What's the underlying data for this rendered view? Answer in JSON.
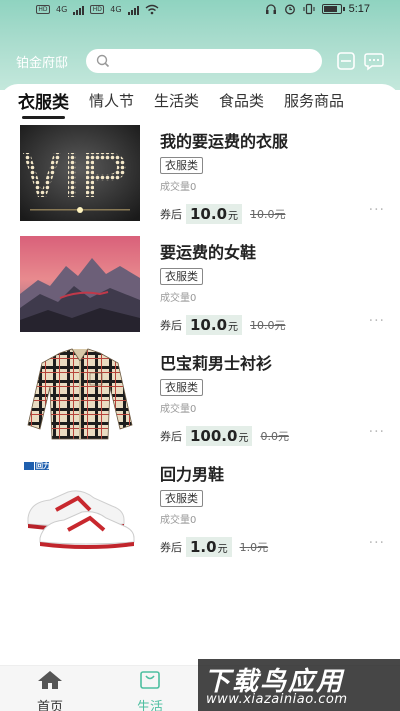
{
  "status_bar": {
    "sim1": "HD",
    "sim2": "HD",
    "net1": "4G",
    "net2": "4G",
    "time": "5:17"
  },
  "header": {
    "location": "铂金府邸",
    "search_placeholder": "",
    "icons": [
      "search-icon",
      "scan-icon",
      "message-icon"
    ],
    "accent_color": "#8fd3c0"
  },
  "tabs": [
    {
      "label": "衣服类",
      "active": true
    },
    {
      "label": "情人节",
      "active": false
    },
    {
      "label": "生活类",
      "active": false
    },
    {
      "label": "食品类",
      "active": false
    },
    {
      "label": "服务商品",
      "active": false
    }
  ],
  "products": [
    {
      "title": "我的要运费的衣服",
      "category": "衣服类",
      "sales": "成交量0",
      "coupon_label": "券后",
      "price": "10.0",
      "unit": "元",
      "original_price": "10.0元",
      "image": "vip-lights-image",
      "image_text": "VIP"
    },
    {
      "title": "要运费的女鞋",
      "category": "衣服类",
      "sales": "成交量0",
      "coupon_label": "券后",
      "price": "10.0",
      "unit": "元",
      "original_price": "10.0元",
      "image": "mountain-sunset-image"
    },
    {
      "title": "巴宝莉男士衬衫",
      "category": "衣服类",
      "sales": "成交量0",
      "coupon_label": "券后",
      "price": "100.0",
      "unit": "元",
      "original_price": "0.0元",
      "image": "plaid-shirt-image"
    },
    {
      "title": "回力男鞋",
      "category": "衣服类",
      "sales": "成交量0",
      "coupon_label": "券后",
      "price": "1.0",
      "unit": "元",
      "original_price": "1.0元",
      "image": "sneakers-image",
      "brand_text": "回力"
    }
  ],
  "more_label": "···",
  "bottom_nav": [
    {
      "label": "首页",
      "icon": "home-icon",
      "active": false
    },
    {
      "label": "生活",
      "icon": "shopping-bag-icon",
      "active": true
    }
  ],
  "colors": {
    "active_nav": "#4dbfa0",
    "price_bg": "#e4eee8"
  },
  "watermark": {
    "title": "下载鸟应用",
    "url": "www.xiazainiao.com"
  }
}
